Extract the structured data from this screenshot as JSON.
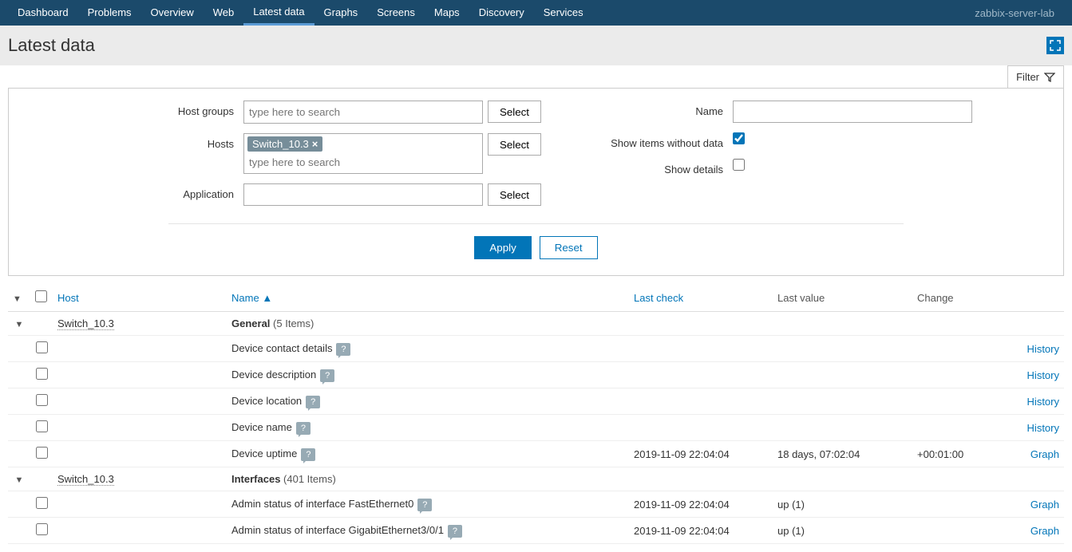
{
  "server_name": "zabbix-server-lab",
  "topnav": [
    "Dashboard",
    "Problems",
    "Overview",
    "Web",
    "Latest data",
    "Graphs",
    "Screens",
    "Maps",
    "Discovery",
    "Services"
  ],
  "active_nav": "Latest data",
  "page_title": "Latest data",
  "filter_tab": "Filter",
  "filter": {
    "host_groups_label": "Host groups",
    "host_groups_placeholder": "type here to search",
    "hosts_label": "Hosts",
    "hosts_tags": [
      "Switch_10.3"
    ],
    "hosts_placeholder": "type here to search",
    "application_label": "Application",
    "application_value": "",
    "name_label": "Name",
    "name_value": "",
    "show_without_data_label": "Show items without data",
    "show_without_data_checked": true,
    "show_details_label": "Show details",
    "show_details_checked": false,
    "select_btn": "Select",
    "apply_btn": "Apply",
    "reset_btn": "Reset"
  },
  "columns": {
    "host": "Host",
    "name": "Name",
    "last_check": "Last check",
    "last_value": "Last value",
    "change": "Change"
  },
  "groups": [
    {
      "host": "Switch_10.3",
      "app": "General",
      "count": "5 Items",
      "items": [
        {
          "name": "Device contact details",
          "help": true,
          "action": "History"
        },
        {
          "name": "Device description",
          "help": true,
          "action": "History"
        },
        {
          "name": "Device location",
          "help": true,
          "action": "History"
        },
        {
          "name": "Device name",
          "help": true,
          "action": "History"
        },
        {
          "name": "Device uptime",
          "help": true,
          "last_check": "2019-11-09 22:04:04",
          "last_value": "18 days, 07:02:04",
          "change": "+00:01:00",
          "action": "Graph"
        }
      ]
    },
    {
      "host": "Switch_10.3",
      "app": "Interfaces",
      "count": "401 Items",
      "items": [
        {
          "name": "Admin status of interface FastEthernet0",
          "help": true,
          "last_check": "2019-11-09 22:04:04",
          "last_value": "up (1)",
          "action": "Graph"
        },
        {
          "name": "Admin status of interface GigabitEthernet3/0/1",
          "help": true,
          "last_check": "2019-11-09 22:04:04",
          "last_value": "up (1)",
          "action": "Graph"
        }
      ]
    }
  ]
}
